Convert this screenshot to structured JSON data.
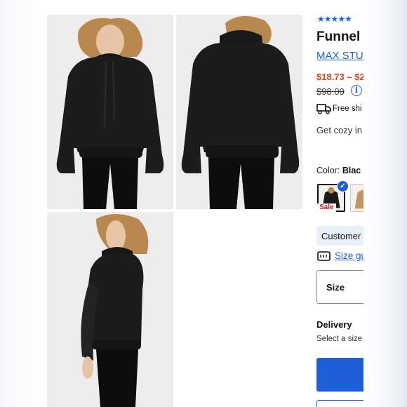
{
  "product": {
    "rating_stars": "★★★★★",
    "title": "Funnel",
    "brand": "MAX STU",
    "price": "$18.73 – $2",
    "original_price": "$98.00",
    "shipping": "Free shi",
    "description": "Get cozy in neck and h",
    "color_label": "Color:",
    "color_value": "Blac",
    "sale_badge": "Sale",
    "customer_pill": "Customer",
    "size_guide": "Size gu",
    "size_label": "Size",
    "delivery_title": "Delivery",
    "delivery_text": "Select a size"
  },
  "icons": {
    "info": "info-icon",
    "truck": "truck-icon",
    "check": "check-icon",
    "ruler": "size-guide-icon"
  },
  "colors": {
    "accent": "#1e5fd9",
    "price": "#d3421c",
    "sale": "#d3102a",
    "garment": "#1c1b1b"
  }
}
